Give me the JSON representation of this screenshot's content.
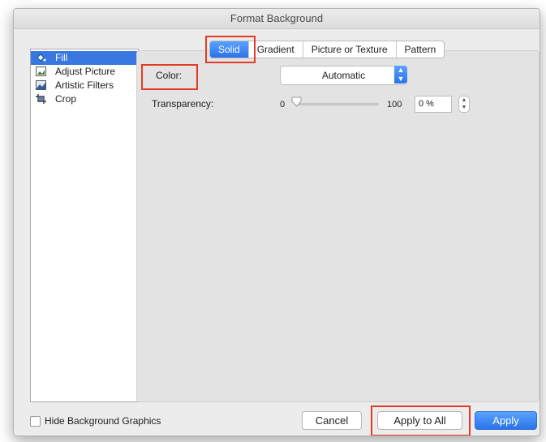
{
  "window": {
    "title": "Format Background"
  },
  "sidebar": {
    "items": [
      {
        "label": "Fill",
        "icon": "paint-bucket-icon",
        "selected": true
      },
      {
        "label": "Adjust Picture",
        "icon": "adjust-picture-icon"
      },
      {
        "label": "Artistic Filters",
        "icon": "artistic-filters-icon"
      },
      {
        "label": "Crop",
        "icon": "crop-icon"
      }
    ]
  },
  "tabs": [
    {
      "label": "Solid",
      "active": true
    },
    {
      "label": "Gradient"
    },
    {
      "label": "Picture or Texture"
    },
    {
      "label": "Pattern"
    }
  ],
  "fill": {
    "color_label": "Color:",
    "color_value": "Automatic",
    "transparency_label": "Transparency:",
    "slider_min": "0",
    "slider_max": "100",
    "transparency_value": "0 %",
    "transparency_percent": 0
  },
  "footer": {
    "hide_graphics_label": "Hide Background Graphics",
    "hide_graphics_checked": false,
    "cancel_label": "Cancel",
    "apply_all_label": "Apply to All",
    "apply_label": "Apply"
  },
  "colors": {
    "accent": "#2b73e8",
    "highlight": "#e53b24"
  }
}
